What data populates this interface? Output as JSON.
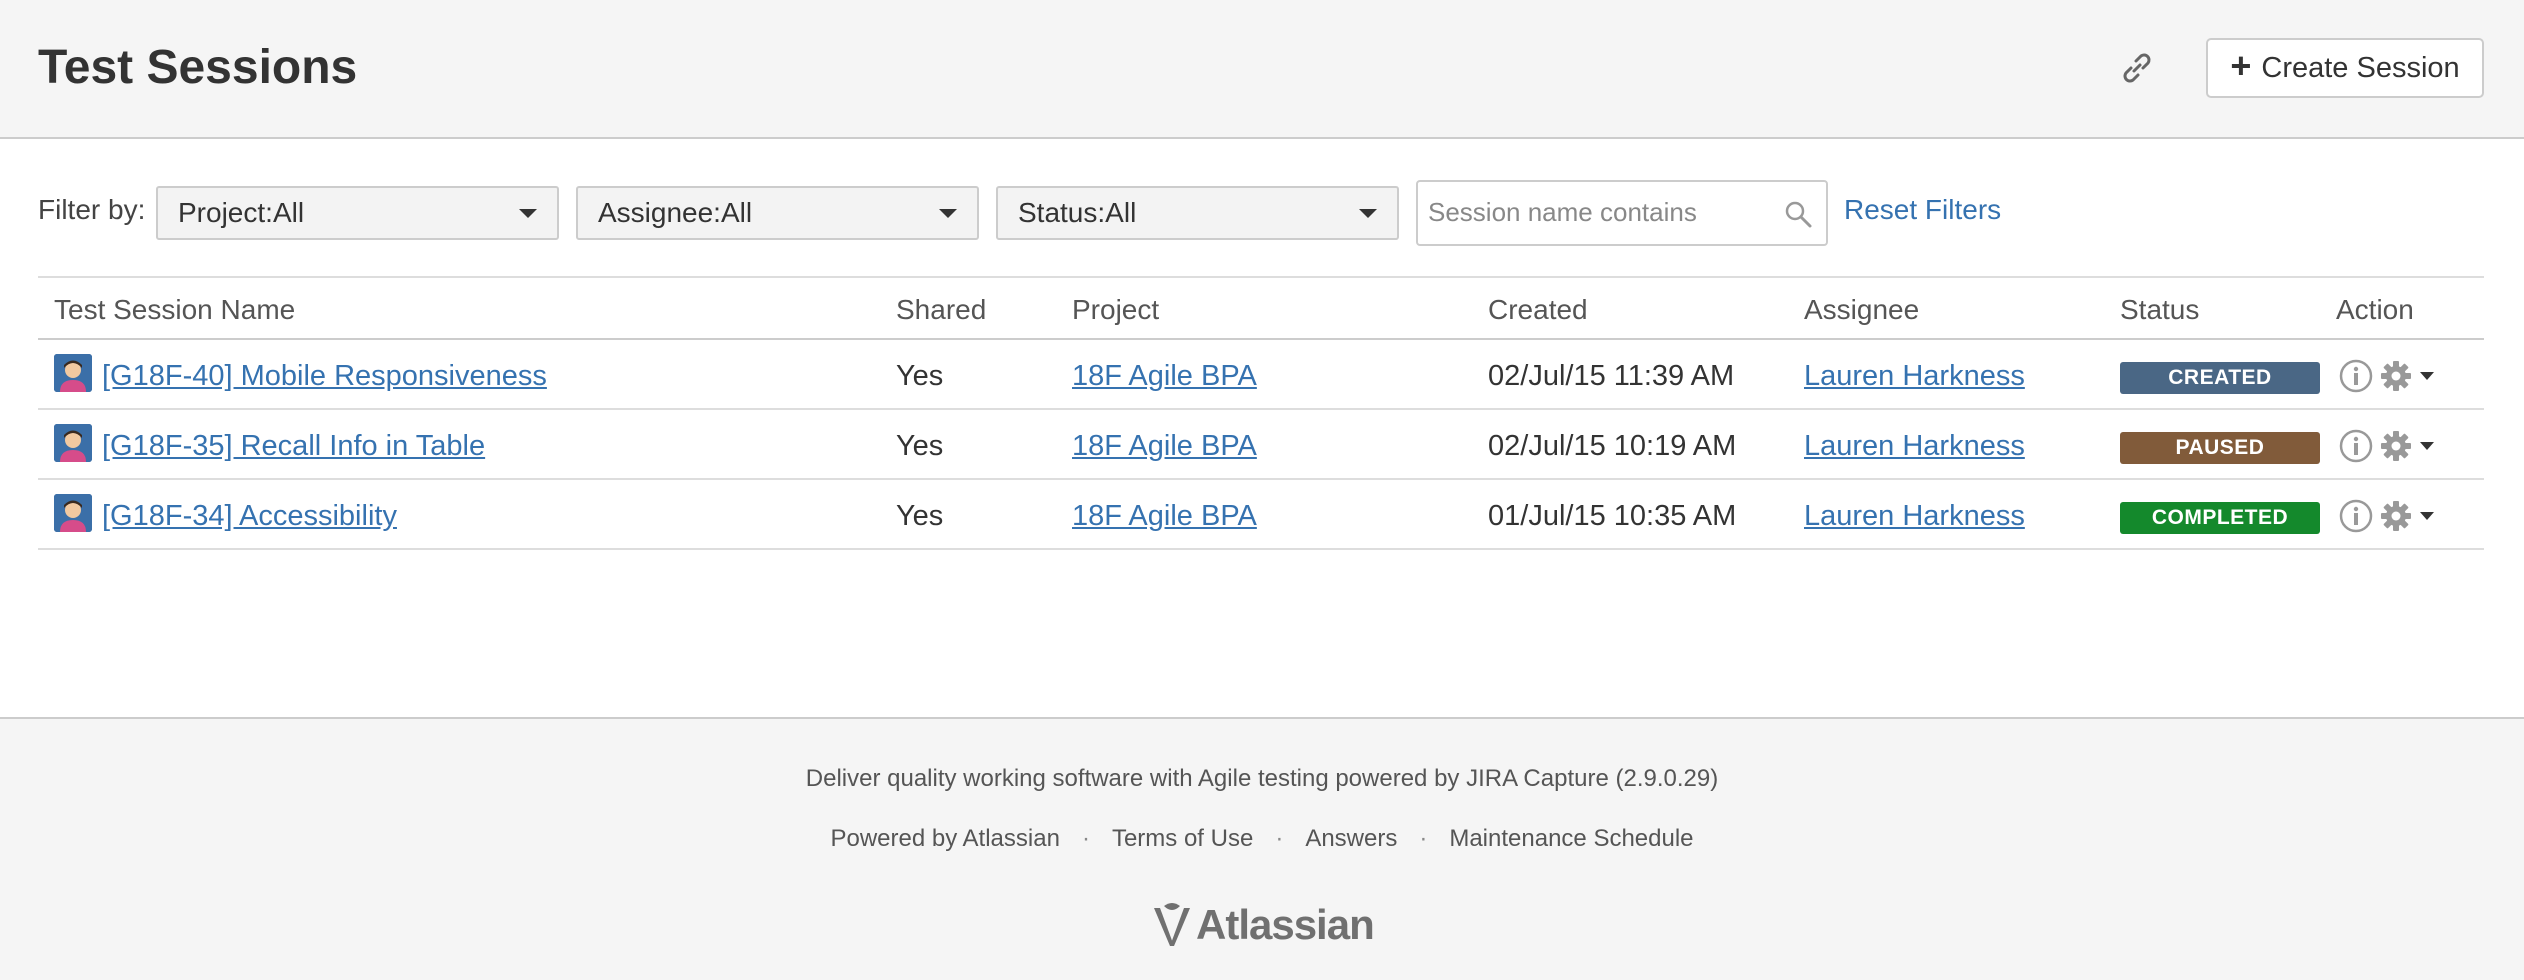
{
  "header": {
    "title": "Test Sessions",
    "create_label": "Create Session"
  },
  "filters": {
    "label": "Filter by:",
    "project": {
      "key": "Project:",
      "value": "All"
    },
    "assignee": {
      "key": "Assignee:",
      "value": "All"
    },
    "status": {
      "key": "Status:",
      "value": "All"
    },
    "search_placeholder": "Session name contains",
    "reset_label": "Reset Filters"
  },
  "table": {
    "columns": [
      "Test Session Name",
      "Shared",
      "Project",
      "Created",
      "Assignee",
      "Status",
      "Action"
    ],
    "rows": [
      {
        "name": "[G18F-40] Mobile Responsiveness",
        "shared": "Yes",
        "project": "18F Agile BPA",
        "created": "02/Jul/15 11:39 AM",
        "assignee": "Lauren Harkness",
        "status": "CREATED",
        "status_color": "#4a6785"
      },
      {
        "name": "[G18F-35] Recall Info in Table",
        "shared": "Yes",
        "project": "18F Agile BPA",
        "created": "02/Jul/15 10:19 AM",
        "assignee": "Lauren Harkness",
        "status": "PAUSED",
        "status_color": "#815b3a"
      },
      {
        "name": "[G18F-34] Accessibility",
        "shared": "Yes",
        "project": "18F Agile BPA",
        "created": "01/Jul/15 10:35 AM",
        "assignee": "Lauren Harkness",
        "status": "COMPLETED",
        "status_color": "#14892c"
      }
    ]
  },
  "footer": {
    "tagline": "Deliver quality working software with Agile testing powered by JIRA Capture (2.9.0.29)",
    "links": [
      "Powered by Atlassian",
      "Terms of Use",
      "Answers",
      "Maintenance Schedule"
    ],
    "logo_text": "Atlassian"
  }
}
